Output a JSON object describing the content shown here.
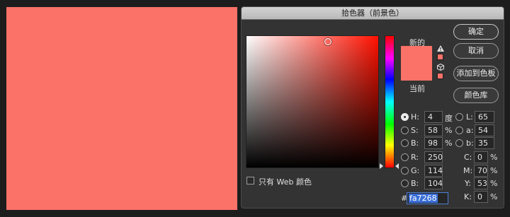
{
  "dialog": {
    "title": "拾色器（前景色）",
    "new_label": "新的",
    "current_label": "当前",
    "web_only_label": "只有 Web 颜色"
  },
  "colors": {
    "foreground": "#fa7268",
    "accent_selection": "#3a6fd8"
  },
  "buttons": {
    "ok": "确定",
    "cancel": "取消",
    "add_to_swatches": "添加到色板",
    "color_libraries": "颜色库"
  },
  "icons": {
    "gamut_warning": "warning-triangle-icon",
    "web_safe": "cube-icon"
  },
  "hsb": {
    "h_label": "H:",
    "h_value": "4",
    "h_unit": "度",
    "s_label": "S:",
    "s_value": "58",
    "s_unit": "%",
    "b_label": "B:",
    "b_value": "98",
    "b_unit": "%"
  },
  "lab": {
    "l_label": "L:",
    "l_value": "65",
    "a_label": "a:",
    "a_value": "54",
    "b_label": "b:",
    "b_value": "35"
  },
  "rgb": {
    "r_label": "R:",
    "r_value": "250",
    "g_label": "G:",
    "g_value": "114",
    "b_label": "B:",
    "b_value": "104"
  },
  "cmyk": {
    "c_label": "C:",
    "c_value": "0",
    "c_unit": "%",
    "m_label": "M:",
    "m_value": "70",
    "m_unit": "%",
    "y_label": "Y:",
    "y_value": "53",
    "y_unit": "%",
    "k_label": "K:",
    "k_value": "0",
    "k_unit": "%"
  },
  "hex": {
    "prefix": "#",
    "value": "fa7268"
  }
}
